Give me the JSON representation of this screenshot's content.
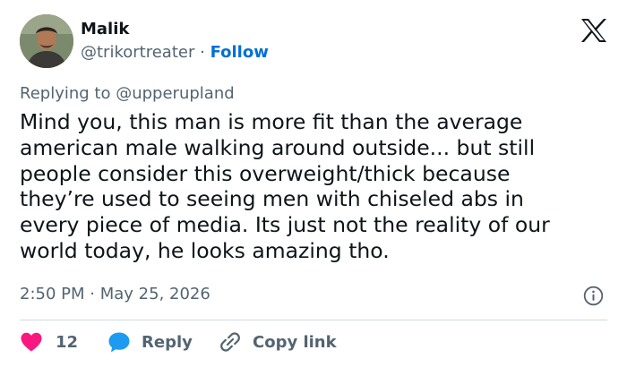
{
  "user": {
    "name": "Malik",
    "handle": "@trikortreater",
    "separator": "·",
    "follow_label": "Follow"
  },
  "reply": {
    "prefix": "Replying to",
    "mention": "@upperupland"
  },
  "tweet": {
    "lines": [
      "Mind you, this man is more fit than the average",
      "american male walking around outside... but still",
      "people consider this overweight/thick because",
      "they’re used to seeing men with chiseled abs in",
      "every piece of media. Its just not the reality of our",
      "world today, he looks amazing tho."
    ],
    "time": "2:50 PM",
    "separator": "·",
    "date": "May 25, 2026"
  },
  "actions": {
    "like_count": "12",
    "reply_label": "Reply",
    "copy_label": "Copy link"
  },
  "colors": {
    "text": "#0f1419",
    "muted": "#536471",
    "link": "#006fd6",
    "like": "#f91880",
    "reply": "#1d9bf0",
    "divider": "#cfd9de"
  },
  "icons": [
    "x-logo",
    "info-icon",
    "heart-icon",
    "reply-bubble-icon",
    "link-icon"
  ]
}
